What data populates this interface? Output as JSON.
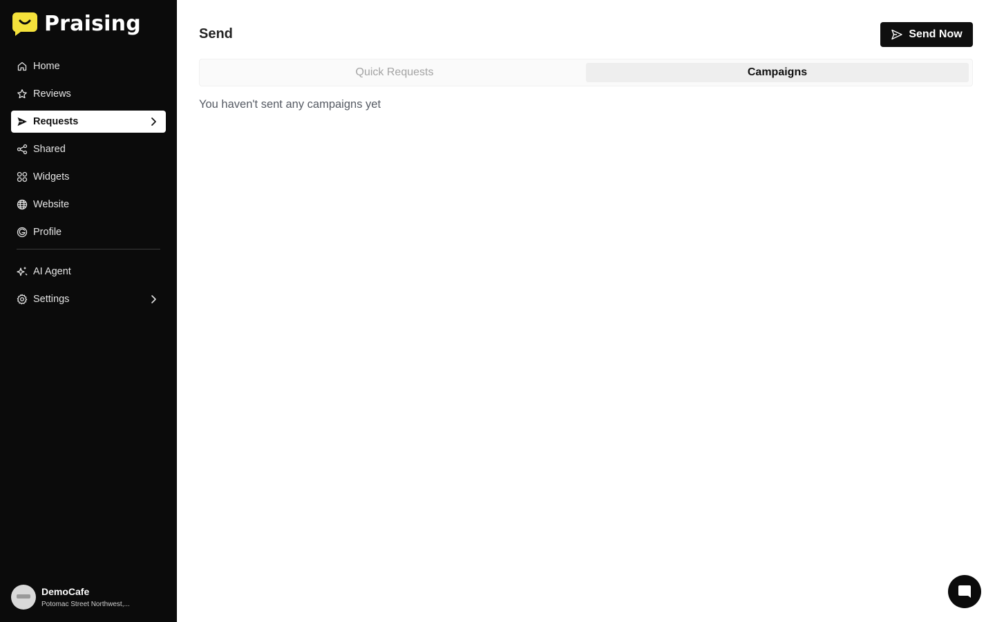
{
  "brand": {
    "name": "Praising",
    "accent": "#f5e23b"
  },
  "sidebar": {
    "items": [
      {
        "label": "Home",
        "icon": "home-icon"
      },
      {
        "label": "Reviews",
        "icon": "star-icon"
      },
      {
        "label": "Requests",
        "icon": "send-icon",
        "active": true
      },
      {
        "label": "Shared",
        "icon": "share-icon"
      },
      {
        "label": "Widgets",
        "icon": "grid-icon"
      },
      {
        "label": "Website",
        "icon": "globe-icon"
      },
      {
        "label": "Profile",
        "icon": "google-icon"
      }
    ],
    "secondary": [
      {
        "label": "AI Agent",
        "icon": "sparkle-icon"
      },
      {
        "label": "Settings",
        "icon": "gear-icon"
      }
    ]
  },
  "account": {
    "name": "DemoCafe",
    "address": "Potomac Street Northwest,..."
  },
  "main": {
    "title": "Send",
    "send_button": "Send Now",
    "tabs": [
      {
        "label": "Quick Requests",
        "active": false
      },
      {
        "label": "Campaigns",
        "active": true
      }
    ],
    "empty_message": "You haven't sent any campaigns yet"
  }
}
